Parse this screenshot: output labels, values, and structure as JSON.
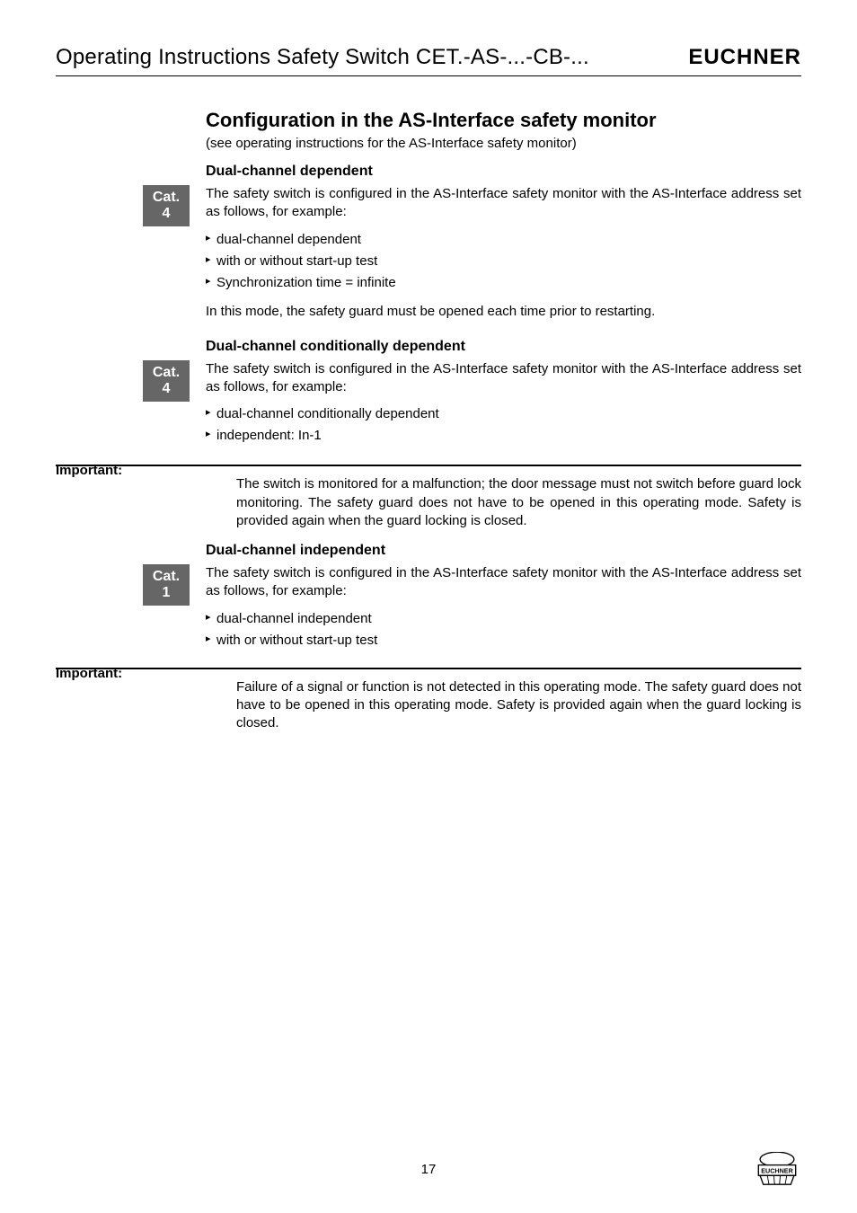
{
  "header": {
    "title": "Operating Instructions Safety Switch CET.-AS-...-CB-...",
    "logo": "EUCHNER"
  },
  "main": {
    "h1": "Configuration in the AS-Interface safety monitor",
    "subtitle": "(see operating instructions for the AS-Interface safety monitor)",
    "section1": {
      "heading": "Dual-channel dependent",
      "cat_label": "Cat.",
      "cat_number": "4",
      "intro": "The safety switch is configured in the AS-Interface safety monitor with the AS-Interface address set as follows, for example:",
      "bullets": [
        "dual-channel dependent",
        "with or without start-up test",
        "Synchronization time = infinite"
      ],
      "outro": "In this mode, the safety guard must be opened each time prior to restarting."
    },
    "section2": {
      "heading": "Dual-channel conditionally dependent",
      "cat_label": "Cat.",
      "cat_number": "4",
      "intro": "The safety switch is configured in the AS-Interface safety monitor with the AS-Interface address set as follows, for example:",
      "bullets": [
        "dual-channel conditionally dependent",
        "independent: In-1"
      ]
    },
    "important1": {
      "label": "Important:",
      "text": "The switch is monitored for a malfunction; the door message must not switch before guard lock monitoring. The safety guard does not have to be opened in this operating mode. Safety is provided again when the guard locking is closed."
    },
    "section3": {
      "heading": "Dual-channel independent",
      "cat_label": "Cat.",
      "cat_number": "1",
      "intro": "The safety switch is configured in the AS-Interface safety monitor with the AS-Interface address set as follows, for example:",
      "bullets": [
        "dual-channel independent",
        "with or without start-up test"
      ]
    },
    "important2": {
      "label": "Important:",
      "text": "Failure of a signal or function is not detected in this operating mode. The safety guard does not have to be opened in this operating mode. Safety is provided again when the guard locking is closed."
    }
  },
  "footer": {
    "page": "17",
    "logo_text": "EUCHNER"
  }
}
